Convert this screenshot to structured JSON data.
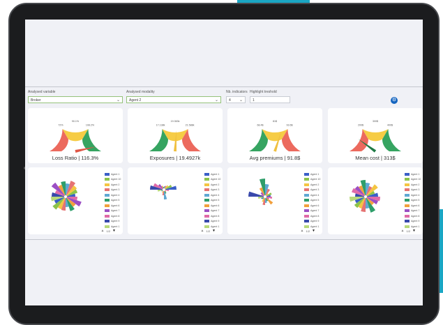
{
  "controls": {
    "analysed_variable": {
      "label": "Analysed variable",
      "value": "Broker"
    },
    "analysed_modality": {
      "label": "Analysed modality",
      "value": "Agent 2"
    },
    "nb_indicators": {
      "label": "Nb. indicators",
      "value": "4"
    },
    "highlight_threshold": {
      "label": "Highlight treshold",
      "value": "1"
    }
  },
  "gauges": [
    {
      "title": "Loss Ratio | 116.3%",
      "ticks": [
        "72%",
        "90.1%",
        "108.2%"
      ],
      "needle": 0.93,
      "type": "red-right"
    },
    {
      "title": "Exposures | 19.4927k",
      "ticks": [
        "17.138k",
        "19.363k",
        "21.588k"
      ],
      "needle": 0.52,
      "type": "red-left"
    },
    {
      "title": "Avg premiums | 91.8$",
      "ticks": [
        "68.4$",
        "81$",
        "93.6$"
      ],
      "needle": 0.6,
      "type": "red-left"
    },
    {
      "title": "Mean cost | 313$",
      "ticks": [
        "200$",
        "300$",
        "400$"
      ],
      "needle": 0.2,
      "type": "red-right"
    }
  ],
  "legend_items": [
    "Agent 1",
    "Agent 10",
    "Agent 2",
    "Agent 3",
    "Agent 4",
    "Agent 5",
    "Agent 6",
    "Agent 7",
    "Agent 8",
    "Agent 9",
    "Agent 1"
  ],
  "legend_colors": [
    "#3a5fc8",
    "#8bc34a",
    "#f4c542",
    "#e57373",
    "#5fa8d3",
    "#2e9e6a",
    "#f2a03d",
    "#9c4fc4",
    "#e06aa8",
    "#3949ab",
    "#b8d97a"
  ],
  "pager": "1/2"
}
